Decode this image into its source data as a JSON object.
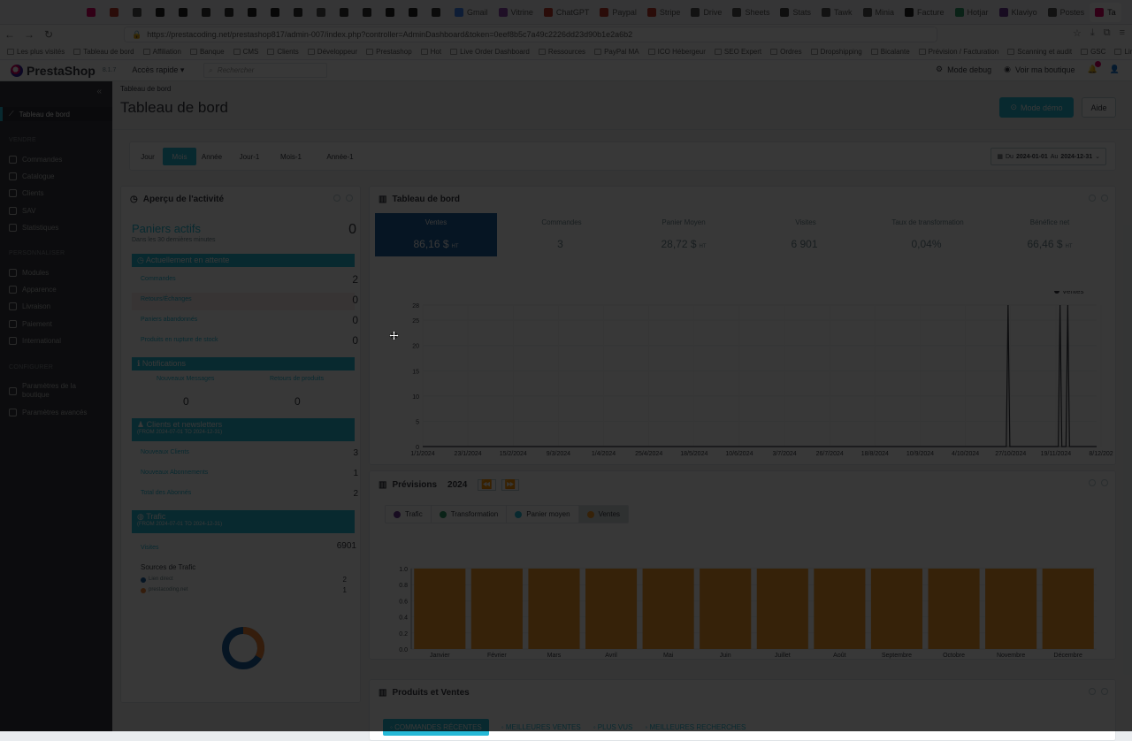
{
  "browser": {
    "tabs": [
      "",
      "",
      "",
      "",
      "",
      "",
      "",
      "",
      "",
      "",
      "",
      "",
      "",
      "",
      "",
      "",
      "Gmail",
      "Vitrine",
      "ChatGPT",
      "Paypal",
      "Stripe",
      "Drive",
      "Sheets",
      "Stats",
      "Tawk",
      "Minia",
      "Facture",
      "Hotjar",
      "Klaviyo",
      "Postes",
      "Ta"
    ],
    "url": "https://prestacoding.net/prestashop817/admin-007/index.php?controller=AdminDashboard&token=0eef8b5c7a49c2226dd23d90b1e2a6b2",
    "bookmarks": [
      "Les plus visités",
      "Tableau de bord",
      "Affiliation",
      "Banque",
      "CMS",
      "Clients",
      "Développeur",
      "Prestashop",
      "Hot",
      "Live Order Dashboard",
      "Ressources",
      "PayPal MA",
      "ICO Hébergeur",
      "SEO Expert",
      "Ordres",
      "Dropshipping",
      "Bicalante",
      "Prévision / Facturation",
      "Scanning et audit",
      "GSC",
      "LinkedIn - Prestashop"
    ]
  },
  "header": {
    "logo": "PrestaShop",
    "version": "8.1.7",
    "quick_access": "Accès rapide ▾",
    "search_placeholder": "Rechercher",
    "debug": "Mode debug",
    "shop": "Voir ma boutique"
  },
  "sidebar": {
    "dashboard": "Tableau de bord",
    "sell_section": "VENDRE",
    "sell": [
      "Commandes",
      "Catalogue",
      "Clients",
      "SAV",
      "Statistiques"
    ],
    "customize_section": "PERSONNALISER",
    "customize": [
      "Modules",
      "Apparence",
      "Livraison",
      "Paiement",
      "International"
    ],
    "configure_section": "CONFIGURER",
    "configure": [
      "Paramètres de la boutique",
      "Paramètres avancés"
    ]
  },
  "page": {
    "breadcrumb": "Tableau de bord",
    "title": "Tableau de bord",
    "demo_button": "Mode démo",
    "help_button": "Aide",
    "periods": [
      "Jour",
      "Mois",
      "Année",
      "Jour-1",
      "Mois-1",
      "Année-1"
    ],
    "active_period": "Mois",
    "date_from_label": "Du",
    "date_from": "2024-01-01",
    "date_to_label": "Au",
    "date_to": "2024-12-31"
  },
  "activity": {
    "title": "Aperçu de l'activité",
    "active_carts_label": "Paniers actifs",
    "active_carts_sub": "Dans les 30 dernières minutes",
    "active_carts_value": "0",
    "pending_header": "Actuellement en attente",
    "pending": [
      {
        "label": "Commandes",
        "value": "2"
      },
      {
        "label": "Retours/Échanges",
        "value": "0"
      },
      {
        "label": "Paniers abandonnés",
        "value": "0"
      },
      {
        "label": "Produits en rupture de stock",
        "value": "0"
      }
    ],
    "notifications_header": "Notifications",
    "notifications": [
      {
        "label": "Nouveaux Messages",
        "value": "0"
      },
      {
        "label": "Retours de produits",
        "value": "0"
      }
    ],
    "customers_header": "Clients et newsletters",
    "customers_sub": "(FROM 2024-07-01 TO 2024-12-31)",
    "customers": [
      {
        "label": "Nouveaux Clients",
        "value": "3"
      },
      {
        "label": "Nouveaux Abonnements",
        "value": "1"
      },
      {
        "label": "Total des Abonnés",
        "value": "2"
      }
    ],
    "traffic_header": "Trafic",
    "traffic_sub": "(FROM 2024-07-01 TO 2024-12-31)",
    "visits_label": "Visites",
    "visits_value": "6901",
    "sources_label": "Sources de Trafic",
    "sources": [
      {
        "label": "Lien direct",
        "value": "2"
      },
      {
        "label": "prestacoding.net",
        "value": "1"
      }
    ],
    "donut_colors": [
      "#1f5f9e",
      "#f0833a"
    ]
  },
  "dashboard_panel": {
    "title": "Tableau de bord",
    "kpis": [
      {
        "label": "Ventes",
        "value": "86,16 $",
        "unit": "HT"
      },
      {
        "label": "Commandes",
        "value": "3",
        "unit": ""
      },
      {
        "label": "Panier Moyen",
        "value": "28,72 $",
        "unit": "HT"
      },
      {
        "label": "Visites",
        "value": "6 901",
        "unit": ""
      },
      {
        "label": "Taux de transformation",
        "value": "0,04%",
        "unit": ""
      },
      {
        "label": "Bénéfice net",
        "value": "66,46 $",
        "unit": "HT"
      }
    ],
    "legend": "Ventes",
    "accent": "#25b9d7"
  },
  "forecast_panel": {
    "title": "Prévisions",
    "year": "2024",
    "legend": [
      {
        "label": "Trafic",
        "color": "#6f3a96"
      },
      {
        "label": "Transformation",
        "color": "#2e9d6b"
      },
      {
        "label": "Panier moyen",
        "color": "#25b9d7"
      },
      {
        "label": "Ventes",
        "color": "#f39a2b"
      }
    ]
  },
  "products_panel": {
    "title": "Produits et Ventes",
    "tabs": [
      "COMMANDES RÉCENTES",
      "MEILLEURES VENTES",
      "PLUS VUS",
      "MEILLEURES RECHERCHES"
    ]
  },
  "chart_data": [
    {
      "type": "line",
      "title": "Tableau de bord",
      "series": [
        {
          "name": "Ventes",
          "x": [
            "2024-10-31",
            "2024-11-27",
            "2024-12-01"
          ],
          "values": [
            28,
            28,
            28
          ]
        }
      ],
      "baseline": 0,
      "x_ticks": [
        "1/1/2024",
        "23/1/2024",
        "15/2/2024",
        "9/3/2024",
        "1/4/2024",
        "25/4/2024",
        "18/5/2024",
        "10/6/2024",
        "3/7/2024",
        "26/7/2024",
        "18/8/2024",
        "10/9/2024",
        "4/10/2024",
        "27/10/2024",
        "19/11/2024",
        "8/12/202"
      ],
      "y_ticks": [
        "0",
        "5",
        "10",
        "15",
        "20",
        "25",
        "28"
      ],
      "ylim": [
        0,
        28
      ],
      "legend_position": "top-right",
      "grid": true
    },
    {
      "type": "bar",
      "title": "Prévisions",
      "categories": [
        "Janvier",
        "Février",
        "Mars",
        "Avril",
        "Mai",
        "Juin",
        "Juillet",
        "Août",
        "Septembre",
        "Octobre",
        "Novembre",
        "Décembre"
      ],
      "series": [
        {
          "name": "Ventes",
          "values": [
            1,
            1,
            1,
            1,
            1,
            1,
            1,
            1,
            1,
            1,
            1,
            1
          ]
        }
      ],
      "y_ticks": [
        "0.0",
        "0.2",
        "0.4",
        "0.6",
        "0.8",
        "1.0"
      ],
      "ylim": [
        0,
        1
      ],
      "color": "#f39a2b"
    }
  ]
}
